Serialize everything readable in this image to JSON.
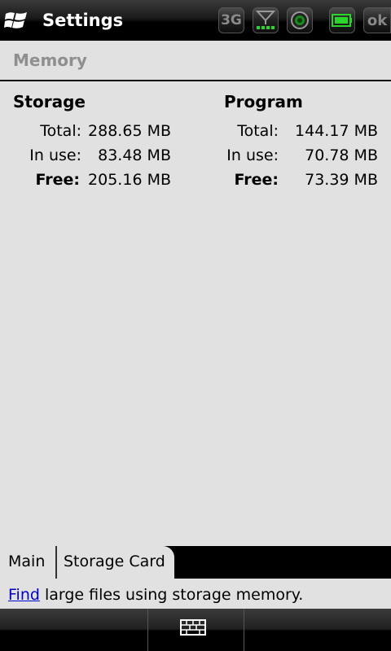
{
  "window": {
    "title": "Settings"
  },
  "status_tray": {
    "network_label": "3G",
    "ok_label": "ok",
    "icons": [
      "network-3g-icon",
      "signal-strength-icon",
      "camera-icon",
      "battery-icon"
    ]
  },
  "section": {
    "title": "Memory"
  },
  "storage": {
    "heading": "Storage",
    "rows": [
      {
        "label": "Total:",
        "value": "288.65 MB"
      },
      {
        "label": "In use:",
        "value": "83.48 MB"
      },
      {
        "label": "Free:",
        "value": "205.16 MB"
      }
    ]
  },
  "program": {
    "heading": "Program",
    "rows": [
      {
        "label": "Total:",
        "value": "144.17 MB"
      },
      {
        "label": "In use:",
        "value": "70.78 MB"
      },
      {
        "label": "Free:",
        "value": "73.39 MB"
      }
    ]
  },
  "tabs": [
    {
      "label": "Main"
    },
    {
      "label": "Storage Card"
    }
  ],
  "hint": {
    "link_text": "Find",
    "rest_text": " large files using storage memory."
  },
  "softkeys": {
    "center_icon": "keyboard-icon"
  },
  "colors": {
    "background": "#e1e1e1",
    "link": "#0000cc",
    "section_title": "#8f8f8f"
  }
}
